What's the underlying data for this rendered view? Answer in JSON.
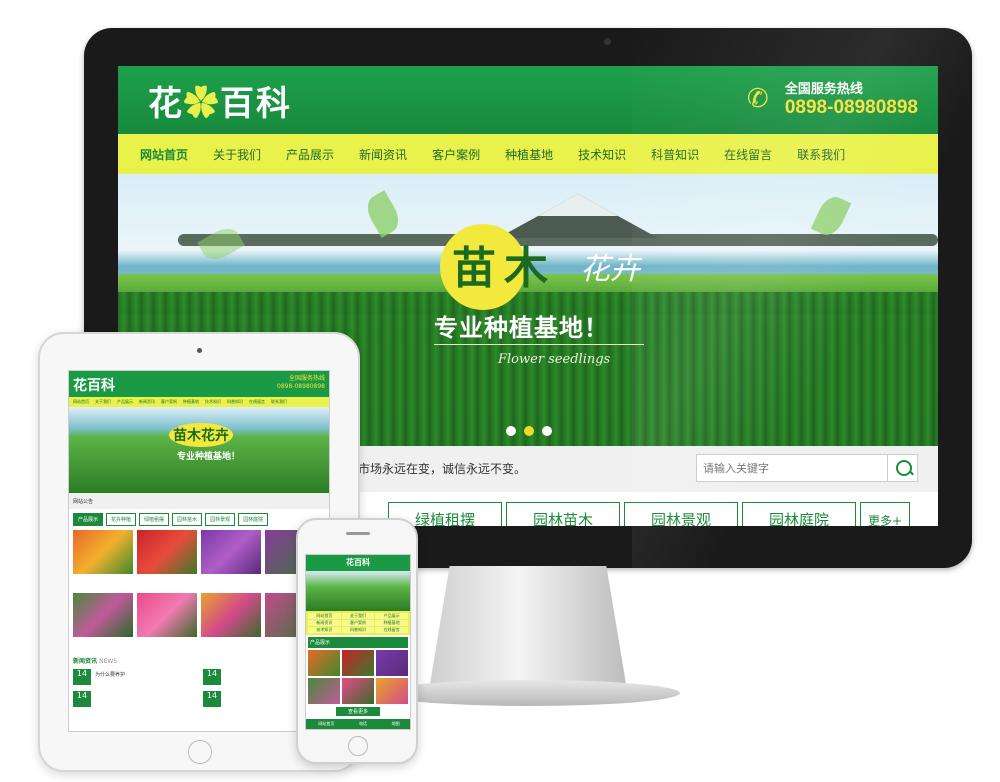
{
  "site": {
    "logo_text": "花",
    "logo_text2": "百科",
    "logo_deco": "",
    "hotline_label": "全国服务热线",
    "hotline_number": "0898-08980898"
  },
  "nav": {
    "items": [
      "网站首页",
      "关于我们",
      "产品展示",
      "新闻资讯",
      "客户案例",
      "种植基地",
      "技术知识",
      "科普知识",
      "在线留言",
      "联系我们"
    ]
  },
  "banner": {
    "title": "苗木",
    "title_script": "花卉",
    "subtitle": "专业种植基地！",
    "english": "Flower seedlings",
    "active_slide": 2,
    "slide_count": 3
  },
  "notice": {
    "text": "市场永远在变，诚信永远不变。"
  },
  "search": {
    "placeholder": "请输入关键字"
  },
  "categories": {
    "items": [
      "绿植租摆",
      "园林苗木",
      "园林景观",
      "园林庭院"
    ],
    "more": "更多+"
  },
  "tablet": {
    "logo": "花百科",
    "phone_label": "全国服务热线",
    "phone_number": "0898-08980898",
    "banner_title": "苗木花卉",
    "banner_sub": "专业种植基地！",
    "notice": "网站公告",
    "products_label": "产品展示",
    "products_en": "PRODUCT",
    "tabs": [
      "产品展示",
      "花卉种植",
      "绿植租摆",
      "园林苗木",
      "园林景观",
      "园林庭院"
    ],
    "news_title": "新闻资讯",
    "news_en": "NEWS",
    "news_date": "14",
    "news_item": "为什么要养护"
  },
  "phone": {
    "logo": "花百科",
    "nav_items": [
      "网站首页",
      "关于我们",
      "产品展示",
      "新闻资讯",
      "客户案例",
      "种植基地",
      "技术知识",
      "科普知识",
      "在线留言",
      "联系我们"
    ],
    "section": "产品展示",
    "more": "查看更多",
    "footer": [
      "网站首页",
      "电话",
      "地图"
    ]
  },
  "colors": {
    "primary_green": "#1b9a45",
    "nav_yellow": "#e9f24a",
    "hotline_yellow": "#f5e23a"
  }
}
